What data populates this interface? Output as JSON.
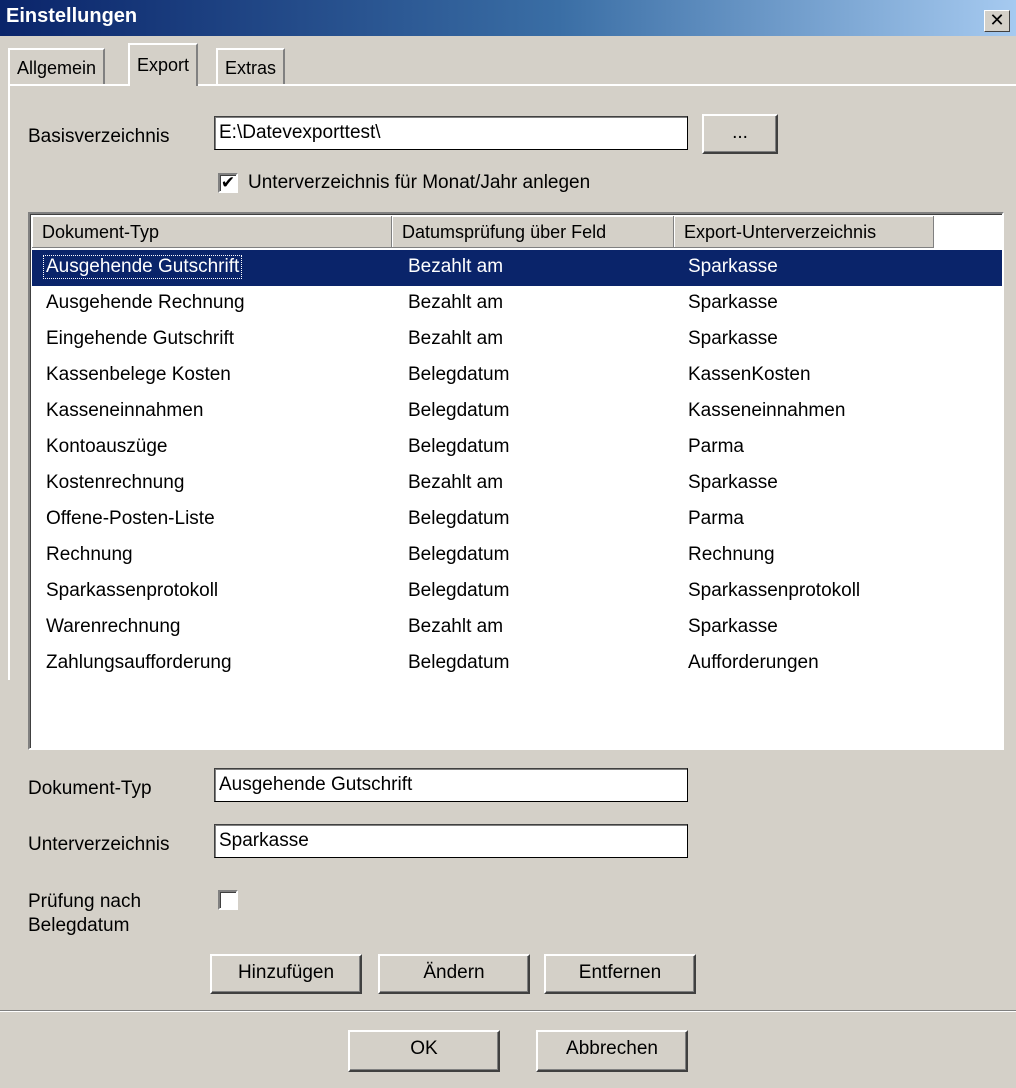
{
  "window": {
    "title": "Einstellungen",
    "close_glyph": "✕"
  },
  "tabs": [
    {
      "label": "Allgemein",
      "active": false
    },
    {
      "label": "Export",
      "active": true
    },
    {
      "label": "Extras",
      "active": false
    }
  ],
  "export": {
    "base_dir_label": "Basisverzeichnis",
    "base_dir_value": "E:\\Datevexporttest\\",
    "browse_label": "...",
    "subdir_checkbox_label": "Unterverzeichnis für Monat/Jahr anlegen",
    "subdir_checked": true
  },
  "list": {
    "columns": [
      "Dokument-Typ",
      "Datumsprüfung über Feld",
      "Export-Unterverzeichnis"
    ],
    "selected_index": 0,
    "rows": [
      [
        "Ausgehende Gutschrift",
        "Bezahlt am",
        "Sparkasse"
      ],
      [
        "Ausgehende Rechnung",
        "Bezahlt am",
        "Sparkasse"
      ],
      [
        "Eingehende Gutschrift",
        "Bezahlt am",
        "Sparkasse"
      ],
      [
        "Kassenbelege Kosten",
        "Belegdatum",
        "KassenKosten"
      ],
      [
        "Kasseneinnahmen",
        "Belegdatum",
        "Kasseneinnahmen"
      ],
      [
        "Kontoauszüge",
        "Belegdatum",
        "Parma"
      ],
      [
        "Kostenrechnung",
        "Bezahlt am",
        "Sparkasse"
      ],
      [
        "Offene-Posten-Liste",
        "Belegdatum",
        "Parma"
      ],
      [
        "Rechnung",
        "Belegdatum",
        "Rechnung"
      ],
      [
        "Sparkassenprotokoll",
        "Belegdatum",
        "Sparkassenprotokoll"
      ],
      [
        "Warenrechnung",
        "Bezahlt am",
        "Sparkasse"
      ],
      [
        "Zahlungsaufforderung",
        "Belegdatum",
        "Aufforderungen"
      ]
    ]
  },
  "detail": {
    "doc_type_label": "Dokument-Typ",
    "doc_type_value": "Ausgehende Gutschrift",
    "subdir_label": "Unterverzeichnis",
    "subdir_value": "Sparkasse",
    "check_label_line1": "Prüfung nach",
    "check_label_line2": "Belegdatum",
    "check_checked": false,
    "add_label": "Hinzufügen",
    "change_label": "Ändern",
    "remove_label": "Entfernen"
  },
  "footer": {
    "ok_label": "OK",
    "cancel_label": "Abbrechen"
  },
  "colors": {
    "selection": "#0a246a",
    "face": "#d4d0c8"
  }
}
